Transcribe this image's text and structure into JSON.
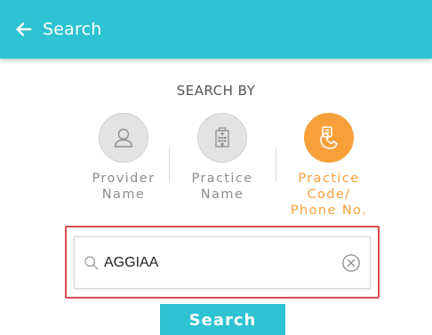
{
  "header": {
    "title": "Search",
    "back_icon": "arrow-left-icon"
  },
  "search_by": {
    "heading": "SEARCH BY",
    "options": [
      {
        "label_lines": [
          "Provider",
          "Name"
        ],
        "icon": "user-icon",
        "selected": false
      },
      {
        "label_lines": [
          "Practice",
          "Name"
        ],
        "icon": "building-icon",
        "selected": false
      },
      {
        "label_lines": [
          "Practice",
          "Code/",
          "Phone No."
        ],
        "icon": "phone-icon",
        "selected": true
      }
    ]
  },
  "search": {
    "value": "AGGIAA",
    "placeholder": "",
    "search_icon": "search-icon",
    "clear_icon": "clear-circle-icon"
  },
  "actions": {
    "search_label": "Search"
  },
  "colors": {
    "primary": "#2dc3d2",
    "accent": "#f7a03a",
    "highlight_border": "#d94b4f",
    "inactive": "#8e8e8e"
  }
}
